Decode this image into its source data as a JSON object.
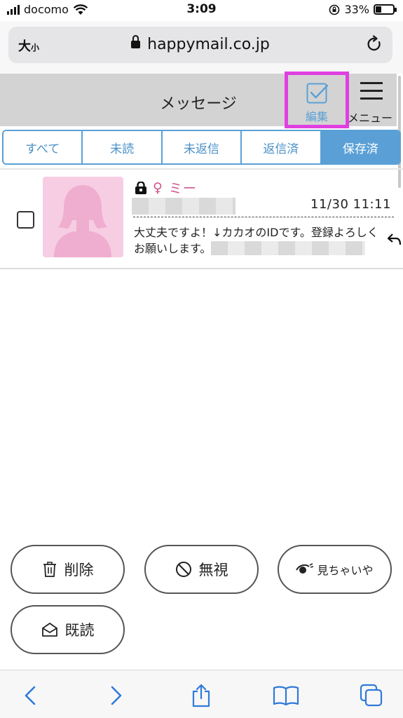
{
  "status_bar": {
    "carrier": "docomo",
    "time": "3:09",
    "battery": "33%"
  },
  "address_bar": {
    "text_size_big": "大",
    "text_size_small": "小",
    "url": "happymail.co.jp"
  },
  "header": {
    "title": "メッセージ",
    "edit_label": "編集",
    "menu_label": "メニュー"
  },
  "tabs": [
    {
      "label": "すべて",
      "active": false
    },
    {
      "label": "未読",
      "active": false
    },
    {
      "label": "未返信",
      "active": false
    },
    {
      "label": "返信済",
      "active": false
    },
    {
      "label": "保存済",
      "active": true
    }
  ],
  "message": {
    "gender_symbol": "♀",
    "sender_name": "ミー",
    "datetime": "11/30 11:11",
    "preview": "大丈夫ですよ！↓カカオのIDです。登録よろしくお願いします。"
  },
  "actions": {
    "delete_label": "削除",
    "ignore_label": "無視",
    "mikai_label": "見ちゃいや",
    "read_label": "既読"
  },
  "colors": {
    "accent_blue": "#5aa0d6",
    "highlight_magenta": "#e040e0",
    "name_pink": "#d2558f",
    "avatar_pink": "#f7cde3"
  }
}
